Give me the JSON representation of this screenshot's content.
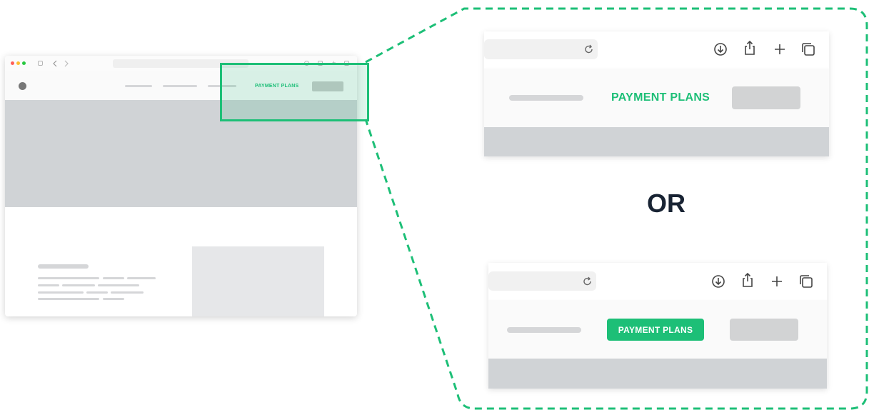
{
  "variant_a": {
    "cta_label": "PAYMENT PLANS"
  },
  "divider": {
    "label": "OR"
  },
  "variant_b": {
    "cta_label": "PAYMENT PLANS"
  },
  "mini_browser": {
    "cta_label": "PAYMENT PLANS"
  },
  "colors": {
    "accent": "#1dbf77",
    "hero_gray": "#d0d3d6",
    "dark_text": "#182333"
  },
  "icons": [
    "sidebar-icon",
    "back-icon",
    "forward-icon",
    "reload-icon",
    "download-icon",
    "share-icon",
    "new-tab-icon",
    "tabs-icon"
  ]
}
